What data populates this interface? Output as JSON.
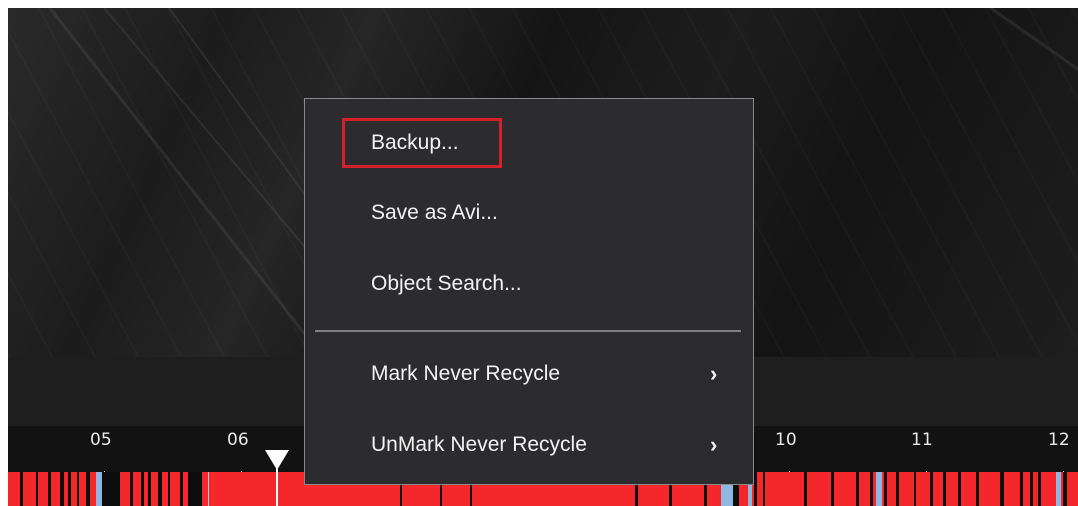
{
  "context_menu": {
    "items": [
      {
        "label": "Backup...",
        "highlighted": true
      },
      {
        "label": "Save as Avi..."
      },
      {
        "label": "Object Search..."
      },
      {
        "label": "Mark Never Recycle",
        "submenu": true
      },
      {
        "label": "UnMark Never Recycle",
        "submenu": true
      }
    ],
    "highlight_color": "#d3202a"
  },
  "timeline": {
    "hour_labels": [
      "05",
      "06",
      "10",
      "11",
      "12"
    ],
    "recording_color": "#f4272a",
    "marked_color": "#8fb7e2"
  }
}
